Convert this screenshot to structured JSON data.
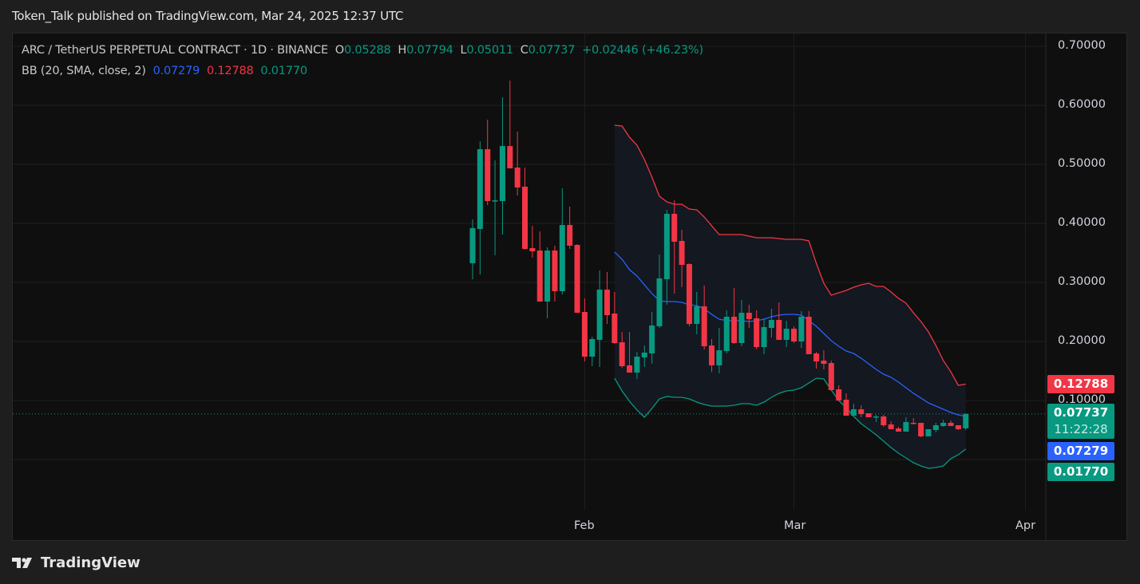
{
  "header": {
    "published": "Token_Talk published on TradingView.com, Mar 24, 2025 12:37 UTC"
  },
  "legend": {
    "symbol": "ARC / TetherUS PERPETUAL CONTRACT · 1D · BINANCE",
    "o_label": "O",
    "o": "0.05288",
    "h_label": "H",
    "h": "0.07794",
    "l_label": "L",
    "l": "0.05011",
    "c_label": "C",
    "c": "0.07737",
    "change": "+0.02446 (+46.23%)",
    "bb_label": "BB (20, SMA, close, 2)",
    "bb_basis": "0.07279",
    "bb_upper": "0.12788",
    "bb_lower": "0.01770"
  },
  "price_axis": {
    "ticks": [
      "0.70000",
      "0.60000",
      "0.50000",
      "0.40000",
      "0.30000",
      "0.20000",
      "0.10000"
    ],
    "tags": {
      "upper": "0.12788",
      "last": "0.07737",
      "countdown": "11:22:28",
      "basis": "0.07279",
      "lower": "0.01770"
    }
  },
  "time_axis": {
    "labels": [
      "Feb",
      "Mar",
      "Apr"
    ]
  },
  "footer": {
    "brand": "TradingView"
  },
  "colors": {
    "up": "#089981",
    "down": "#f23645",
    "basis": "#2962ff",
    "upper": "#f23645",
    "lower": "#089981",
    "band_fill": "#131821"
  },
  "chart_data": {
    "type": "candlestick",
    "title": "ARC / TetherUS PERPETUAL CONTRACT · 1D · BINANCE",
    "first_date": "2025-01-17",
    "last_date": "2025-03-24",
    "ylim": [
      -0.07,
      0.72
    ],
    "time_ticks": [
      {
        "label": "Feb",
        "day_offset": 15
      },
      {
        "label": "Mar",
        "day_offset": 43
      },
      {
        "label": "Apr",
        "day_offset": 74
      }
    ],
    "ohlc": [
      [
        0.3324,
        0.4068,
        0.3054,
        0.392
      ],
      [
        0.3905,
        0.539,
        0.3135,
        0.5257
      ],
      [
        0.5257,
        0.5757,
        0.431,
        0.4378
      ],
      [
        0.439,
        0.5068,
        0.346,
        0.439
      ],
      [
        0.4378,
        0.6135,
        0.381,
        0.531
      ],
      [
        0.531,
        0.642,
        0.4932,
        0.4932
      ],
      [
        0.4946,
        0.5554,
        0.4473,
        0.4608
      ],
      [
        0.4622,
        0.4946,
        0.3554,
        0.3568
      ],
      [
        0.3581,
        0.396,
        0.342,
        0.3527
      ],
      [
        0.354,
        0.3865,
        0.2676,
        0.2676
      ],
      [
        0.2676,
        0.3595,
        0.2392,
        0.354
      ],
      [
        0.354,
        0.3622,
        0.2676,
        0.2851
      ],
      [
        0.2851,
        0.4595,
        0.2797,
        0.3973
      ],
      [
        0.3973,
        0.4284,
        0.3568,
        0.3622
      ],
      [
        0.3635,
        0.3649,
        0.2486,
        0.2486
      ],
      [
        0.25,
        0.273,
        0.1662,
        0.1743
      ],
      [
        0.1743,
        0.2081,
        0.1581,
        0.2041
      ],
      [
        0.2027,
        0.3203,
        0.1568,
        0.2878
      ],
      [
        0.2878,
        0.3176,
        0.2297,
        0.2446
      ],
      [
        0.2473,
        0.2838,
        0.196,
        0.1973
      ],
      [
        0.1986,
        0.2162,
        0.1554,
        0.1581
      ],
      [
        0.1595,
        0.2162,
        0.1473,
        0.1473
      ],
      [
        0.1473,
        0.1824,
        0.1365,
        0.1743
      ],
      [
        0.173,
        0.1932,
        0.1568,
        0.1811
      ],
      [
        0.1797,
        0.25,
        0.1622,
        0.227
      ],
      [
        0.2257,
        0.3473,
        0.223,
        0.3068
      ],
      [
        0.3054,
        0.423,
        0.2622,
        0.4162
      ],
      [
        0.4162,
        0.4392,
        0.281,
        0.3689
      ],
      [
        0.3703,
        0.3892,
        0.2919,
        0.3297
      ],
      [
        0.3311,
        0.3324,
        0.2257,
        0.2297
      ],
      [
        0.2297,
        0.2838,
        0.2122,
        0.2595
      ],
      [
        0.2595,
        0.2946,
        0.1865,
        0.1919
      ],
      [
        0.1932,
        0.2041,
        0.1486,
        0.1595
      ],
      [
        0.1595,
        0.223,
        0.146,
        0.1851
      ],
      [
        0.1838,
        0.2527,
        0.1797,
        0.2419
      ],
      [
        0.2419,
        0.2905,
        0.196,
        0.1973
      ],
      [
        0.1973,
        0.2703,
        0.1919,
        0.2486
      ],
      [
        0.2486,
        0.2622,
        0.223,
        0.2378
      ],
      [
        0.2392,
        0.2527,
        0.1865,
        0.1905
      ],
      [
        0.1905,
        0.2392,
        0.1784,
        0.2243
      ],
      [
        0.223,
        0.2554,
        0.2068,
        0.2365
      ],
      [
        0.2365,
        0.2662,
        0.2027,
        0.2027
      ],
      [
        0.2027,
        0.2351,
        0.1905,
        0.2216
      ],
      [
        0.2216,
        0.2257,
        0.1973,
        0.2
      ],
      [
        0.2,
        0.2514,
        0.1892,
        0.2419
      ],
      [
        0.2419,
        0.2514,
        0.1784,
        0.1784
      ],
      [
        0.1797,
        0.1824,
        0.1541,
        0.1662
      ],
      [
        0.1676,
        0.1851,
        0.1527,
        0.1622
      ],
      [
        0.1635,
        0.1676,
        0.1176,
        0.1176
      ],
      [
        0.1189,
        0.1257,
        0.1,
        0.1
      ],
      [
        0.1014,
        0.1122,
        0.0743,
        0.0743
      ],
      [
        0.0743,
        0.0946,
        0.0743,
        0.0851
      ],
      [
        0.0851,
        0.0919,
        0.0716,
        0.077
      ],
      [
        0.0784,
        0.0784,
        0.0716,
        0.0716
      ],
      [
        0.0725,
        0.0757,
        0.0635,
        0.073
      ],
      [
        0.073,
        0.0757,
        0.0554,
        0.0581
      ],
      [
        0.0595,
        0.0649,
        0.0514,
        0.0514
      ],
      [
        0.0527,
        0.0554,
        0.0473,
        0.0473
      ],
      [
        0.0473,
        0.0716,
        0.0473,
        0.0635
      ],
      [
        0.0622,
        0.0703,
        0.0595,
        0.0608
      ],
      [
        0.0622,
        0.0622,
        0.0378,
        0.0392
      ],
      [
        0.0392,
        0.0514,
        0.0392,
        0.0514
      ],
      [
        0.05,
        0.0622,
        0.0459,
        0.0581
      ],
      [
        0.0568,
        0.0676,
        0.0554,
        0.0622
      ],
      [
        0.0622,
        0.0662,
        0.0568,
        0.0568
      ],
      [
        0.0581,
        0.0581,
        0.05,
        0.0514
      ],
      [
        0.05288,
        0.07794,
        0.05011,
        0.07737
      ]
    ],
    "bb_start_index": 19,
    "bb_upper": [
      0.5662,
      0.5649,
      0.5459,
      0.5324,
      0.5081,
      0.4784,
      0.4459,
      0.4365,
      0.4324,
      0.4324,
      0.4243,
      0.423,
      0.4108,
      0.3959,
      0.3811,
      0.3811,
      0.3811,
      0.3811,
      0.3784,
      0.3757,
      0.3757,
      0.3757,
      0.3743,
      0.373,
      0.373,
      0.373,
      0.3703,
      0.3324,
      0.2986,
      0.2784,
      0.2824,
      0.2865,
      0.2919,
      0.2959,
      0.2986,
      0.2932,
      0.2932,
      0.2838,
      0.273,
      0.2649,
      0.2486,
      0.2338,
      0.2162,
      0.1932,
      0.1676,
      0.1486,
      0.1257,
      0.12788
    ],
    "bb_basis": [
      0.3514,
      0.3392,
      0.3216,
      0.3108,
      0.2959,
      0.2811,
      0.2689,
      0.2676,
      0.2676,
      0.2662,
      0.2622,
      0.2608,
      0.2554,
      0.2459,
      0.2378,
      0.2351,
      0.2351,
      0.2351,
      0.2338,
      0.2351,
      0.2378,
      0.2419,
      0.2446,
      0.2459,
      0.2459,
      0.2446,
      0.2351,
      0.2257,
      0.2135,
      0.2014,
      0.1919,
      0.1838,
      0.1797,
      0.1716,
      0.1622,
      0.1527,
      0.1446,
      0.1392,
      0.1311,
      0.1216,
      0.1122,
      0.1041,
      0.0959,
      0.0905,
      0.0851,
      0.0797,
      0.0757,
      0.07279
    ],
    "bb_lower": [
      0.1378,
      0.1162,
      0.0986,
      0.0838,
      0.0716,
      0.0865,
      0.1027,
      0.1068,
      0.1054,
      0.1054,
      0.1027,
      0.0973,
      0.0932,
      0.0905,
      0.0905,
      0.0905,
      0.0919,
      0.0946,
      0.0946,
      0.0919,
      0.0973,
      0.1054,
      0.1122,
      0.1162,
      0.1176,
      0.1216,
      0.1297,
      0.1378,
      0.1365,
      0.1176,
      0.1,
      0.0878,
      0.073,
      0.0608,
      0.0514,
      0.0419,
      0.0311,
      0.0203,
      0.0108,
      0.0027,
      -0.0054,
      -0.0108,
      -0.0149,
      -0.0135,
      -0.0108,
      0.0014,
      0.0081,
      0.0177
    ],
    "last_price": 0.07737
  }
}
